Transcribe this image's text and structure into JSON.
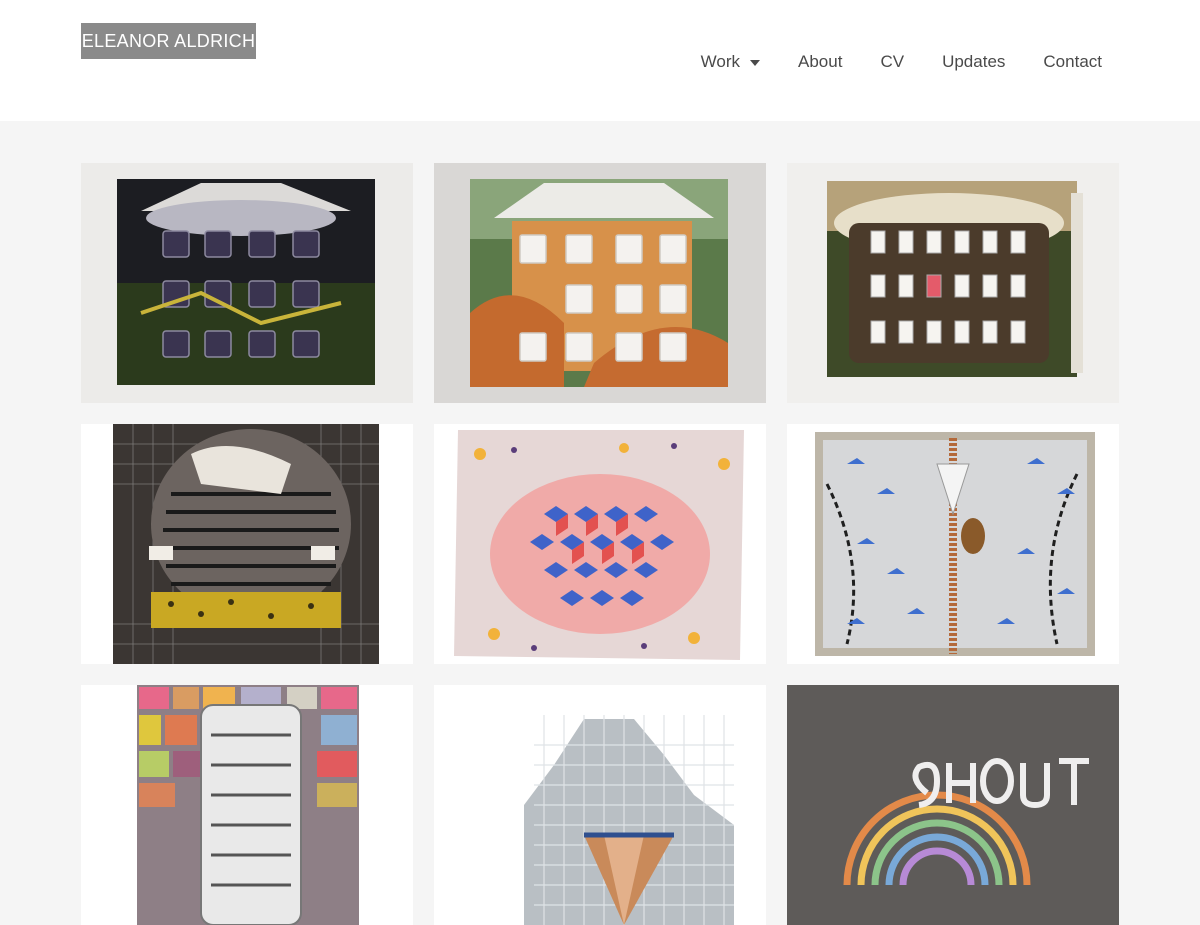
{
  "site": {
    "logo_text": "ELEANOR ALDRICH"
  },
  "nav": {
    "items": [
      {
        "label": "Work",
        "has_dropdown": true
      },
      {
        "label": "About"
      },
      {
        "label": "CV"
      },
      {
        "label": "Updates"
      },
      {
        "label": "Contact"
      }
    ],
    "dropdown_icon": "caret-down-icon"
  },
  "gallery": {
    "tiles": [
      {
        "subject": "night-tent-window-grid-painting"
      },
      {
        "subject": "daytime-tent-white-windows-painting"
      },
      {
        "subject": "tan-canvas-window-grid-painting"
      },
      {
        "subject": "black-striped-textured-painting"
      },
      {
        "subject": "pink-blue-cube-pattern-painting"
      },
      {
        "subject": "grey-zipper-birds-painting"
      },
      {
        "subject": "colorful-tile-collage-painting"
      },
      {
        "subject": "mosaic-tile-fan-sculpture"
      },
      {
        "subject": "rainbow-shout-relief-painting"
      }
    ]
  },
  "colors": {
    "header_bg": "#ffffff",
    "page_bg": "#f5f5f5",
    "logo_bg": "#8a8a8a",
    "logo_text": "#ffffff",
    "nav_text": "#4a4a4a"
  }
}
